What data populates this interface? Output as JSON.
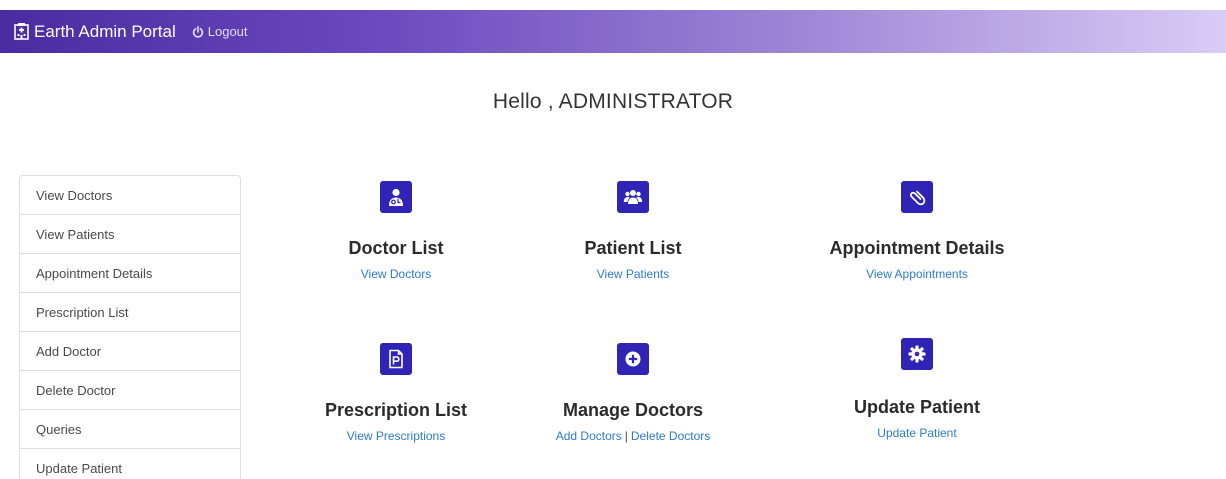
{
  "navbar": {
    "brand": "Earth Admin Portal",
    "logout": "Logout"
  },
  "greeting": "Hello , ADMINISTRATOR",
  "sidebar": {
    "items": [
      {
        "label": "View Doctors"
      },
      {
        "label": "View Patients"
      },
      {
        "label": "Appointment Details"
      },
      {
        "label": "Prescription List"
      },
      {
        "label": "Add Doctor"
      },
      {
        "label": "Delete Doctor"
      },
      {
        "label": "Queries"
      },
      {
        "label": "Update Patient"
      }
    ]
  },
  "cards": {
    "doctor_list": {
      "title": "Doctor List",
      "link": "View Doctors",
      "icon": "user-doctor-icon"
    },
    "patient_list": {
      "title": "Patient List",
      "link": "View Patients",
      "icon": "users-icon"
    },
    "appointment_details": {
      "title": "Appointment Details",
      "link": "View Appointments",
      "icon": "paperclip-icon"
    },
    "prescription_list": {
      "title": "Prescription List",
      "link": "View Prescriptions",
      "icon": "prescription-file-icon"
    },
    "manage_doctors": {
      "title": "Manage Doctors",
      "link_add": "Add Doctors",
      "separator": "|",
      "link_delete": "Delete Doctors",
      "icon": "plus-circle-icon"
    },
    "update_patient": {
      "title": "Update Patient",
      "link": "Update Patient",
      "icon": "gear-icon"
    }
  },
  "colors": {
    "navbar_start": "#4a2ca0",
    "navbar_end": "#d9ccf6",
    "icon_box": "#2f24b5",
    "link": "#2d7bd0"
  }
}
